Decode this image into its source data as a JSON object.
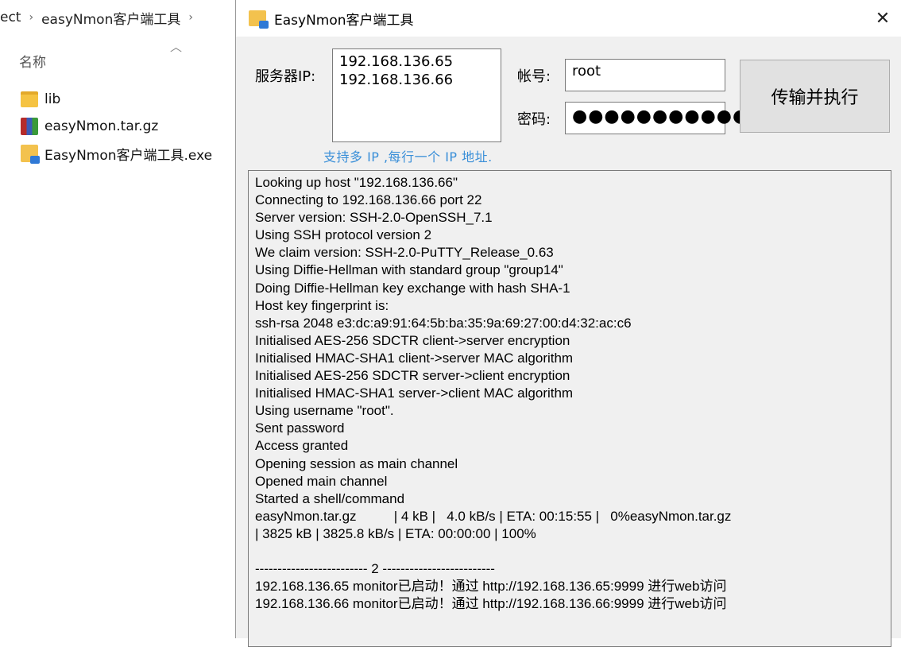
{
  "explorer": {
    "breadcrumb": [
      "ect",
      "easyNmon客户端工具"
    ],
    "column_header": "名称",
    "files": [
      {
        "name": "lib",
        "icon": "folder-icon"
      },
      {
        "name": "easyNmon.tar.gz",
        "icon": "rar-archive-icon"
      },
      {
        "name": "EasyNmon客户端工具.exe",
        "icon": "exe-app-icon"
      }
    ]
  },
  "window": {
    "title": "EasyNmon客户端工具",
    "server_ip_label": "服务器IP:",
    "server_ips": "192.168.136.65\n192.168.136.66",
    "ip_hint": "支持多 IP ,每行一个 IP 地址.",
    "account_label": "帐号:",
    "account_value": "root",
    "password_label": "密码:",
    "password_value": "●●●●●●●●●●●",
    "action_button": "传输并执行",
    "log_lines": [
      "Looking up host \"192.168.136.66\"",
      "Connecting to 192.168.136.66 port 22",
      "Server version: SSH-2.0-OpenSSH_7.1",
      "Using SSH protocol version 2",
      "We claim version: SSH-2.0-PuTTY_Release_0.63",
      "Using Diffie-Hellman with standard group \"group14\"",
      "Doing Diffie-Hellman key exchange with hash SHA-1",
      "Host key fingerprint is:",
      "ssh-rsa 2048 e3:dc:a9:91:64:5b:ba:35:9a:69:27:00:d4:32:ac:c6",
      "Initialised AES-256 SDCTR client->server encryption",
      "Initialised HMAC-SHA1 client->server MAC algorithm",
      "Initialised AES-256 SDCTR server->client encryption",
      "Initialised HMAC-SHA1 server->client MAC algorithm",
      "Using username \"root\".",
      "Sent password",
      "Access granted",
      "Opening session as main channel",
      "Opened main channel",
      "Started a shell/command",
      "easyNmon.tar.gz          | 4 kB |   4.0 kB/s | ETA: 00:15:55 |   0%easyNmon.tar.gz",
      "| 3825 kB | 3825.8 kB/s | ETA: 00:00:00 | 100%",
      "",
      "------------------------- 2 -------------------------",
      "192.168.136.65 monitor已启动！通过 http://192.168.136.65:9999 进行web访问",
      "192.168.136.66 monitor已启动！通过 http://192.168.136.66:9999 进行web访问"
    ]
  }
}
